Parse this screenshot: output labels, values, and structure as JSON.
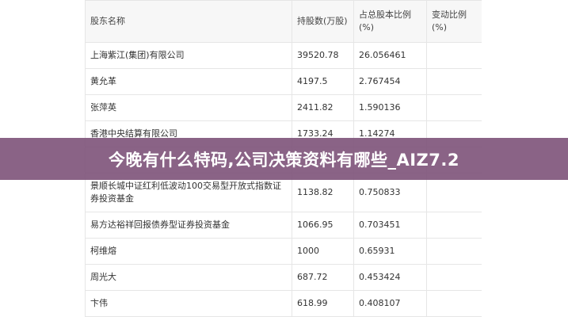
{
  "table": {
    "headers": [
      "股东名称",
      "持股数(万股)",
      "占总股本比例(%)",
      "变动比例(%)"
    ],
    "rows": [
      {
        "name": "上海紫江(集团)有限公司",
        "shares": "39520.78",
        "ratio": "26.056461",
        "change": ""
      },
      {
        "name": "黄允革",
        "shares": "4197.5",
        "ratio": "2.767454",
        "change": ""
      },
      {
        "name": "张萍英",
        "shares": "2411.82",
        "ratio": "1.590136",
        "change": ""
      },
      {
        "name": "香港中央结算有限公司",
        "shares": "1733.24",
        "ratio": "1.14274",
        "change": ""
      },
      {
        "name": "",
        "shares": "",
        "ratio": "",
        "change": ""
      },
      {
        "name": "景顺长城中证红利低波动100交易型开放式指数证券投资基金",
        "shares": "1138.82",
        "ratio": "0.750833",
        "change": ""
      },
      {
        "name": "易方达裕祥回报债券型证券投资基金",
        "shares": "1066.95",
        "ratio": "0.703451",
        "change": ""
      },
      {
        "name": "柯维熔",
        "shares": "1000",
        "ratio": "0.65931",
        "change": ""
      },
      {
        "name": "周光大",
        "shares": "687.72",
        "ratio": "0.453424",
        "change": ""
      },
      {
        "name": "卞伟",
        "shares": "618.99",
        "ratio": "0.408107",
        "change": ""
      }
    ]
  },
  "banner": {
    "title": "今晚有什么特码,公司决策资料有哪些_AIZ7.2"
  },
  "colors": {
    "banner_bg": "#80567c",
    "header_bg": "#f7f7f7",
    "border": "#e6e6e6"
  }
}
